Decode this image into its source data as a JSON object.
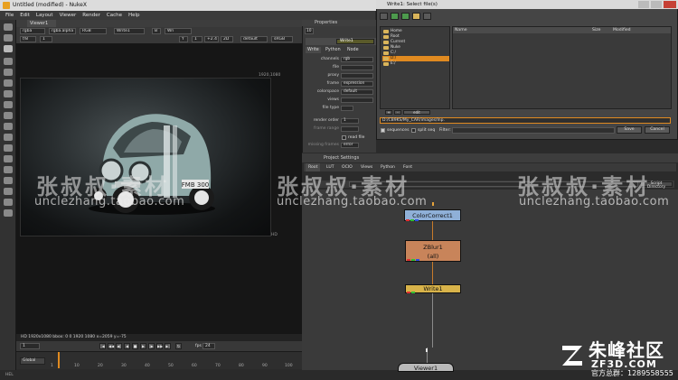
{
  "window": {
    "title": "Untitled (modified) - NukeX"
  },
  "menu": [
    "File",
    "Edit",
    "Layout",
    "Viewer",
    "Render",
    "Cache",
    "Help"
  ],
  "viewer": {
    "tab": "Viewer1",
    "controls_row1": [
      "rgba",
      "rgba.alpha",
      "RGB",
      "Write1",
      "B",
      "Wri"
    ],
    "controls_row2": [
      "f/8",
      "1",
      "Y",
      "1",
      "+2.4",
      "2D",
      "default",
      "sRGB"
    ],
    "res_top": "1920,1080",
    "res_bottom": "HD",
    "info_line": "HD 1920x1080  bbox: 0 0 1920 1080  x=2059 y=-75",
    "plate_text": "FMB 300"
  },
  "playback": {
    "fps_label": "fps",
    "fps_value": "24",
    "frame": "1"
  },
  "timeline": {
    "global_label": "Global",
    "ticks": [
      "1",
      "10",
      "20",
      "30",
      "40",
      "50",
      "60",
      "70",
      "80",
      "90",
      "100"
    ]
  },
  "status": {
    "text": "HEL"
  },
  "properties": {
    "title": "Properties",
    "count": "10",
    "node_name": "Write1",
    "tabs": [
      "Write",
      "Python",
      "Node"
    ],
    "rows": [
      {
        "label": "channels",
        "value": "rgb"
      },
      {
        "label": "file",
        "value": ""
      },
      {
        "label": "proxy",
        "value": ""
      },
      {
        "label": "frame",
        "value": "expression"
      },
      {
        "label": "colorspace",
        "value": "default"
      },
      {
        "label": "views",
        "value": ""
      },
      {
        "label": "file type",
        "value": ""
      },
      {
        "label": "render order",
        "value": "1"
      },
      {
        "label": "frame range",
        "value": ""
      },
      {
        "label": "read file",
        "value": ""
      },
      {
        "label": "missing frames",
        "value": "error"
      }
    ]
  },
  "dialog": {
    "title": "Write1: Select file(s)",
    "dirs": [
      "Home",
      "Root",
      "Current",
      "Nuke",
      "C:/",
      "D:/",
      "E:/"
    ],
    "selected_dir": "D:/",
    "columns": {
      "name": "Name",
      "size": "Size",
      "modified": "Modified"
    },
    "dir_buttons": [
      "+",
      "-",
      "edit"
    ],
    "path": "D:/CB9KS/My_CAR/images/Inp.",
    "sequences_label": "sequences",
    "split_seq_label": "split seq",
    "filter_label": "Filter:",
    "save_label": "Save",
    "cancel_label": "Cancel"
  },
  "project": {
    "title": "Project Settings",
    "tabs": [
      "Root",
      "LUT",
      "OCIO",
      "Views",
      "Python",
      "Font"
    ],
    "dir_button": "Script Directory"
  },
  "nodes": {
    "cc": "ColorCorrect1",
    "zb_name": "ZBlur1",
    "zb_sub": "(all)",
    "wr": "Write1",
    "vw": "Viewer1"
  },
  "watermark": {
    "cn": "张叔叔·素材",
    "en": "unclezhang.taobao.com",
    "brand": "朱峰社区",
    "domain": "ZF3D.COM",
    "hotline": "官方总群：1289558555"
  },
  "colors": {
    "accent": "#e08a20",
    "node_cc": "#8fb0d8",
    "node_zb": "#c8845a",
    "node_wr": "#d8b34a"
  }
}
